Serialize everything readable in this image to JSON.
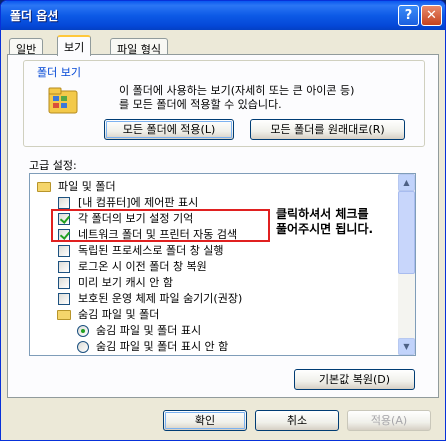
{
  "window": {
    "title": "폴더 옵션",
    "help": "?",
    "close": "✕"
  },
  "tabs": [
    "일반",
    "보기",
    "파일 형식"
  ],
  "folder_views": {
    "group_title": "폴더 보기",
    "description": [
      "이 폴더에 사용하는 보기(자세히 또는 큰 아이콘 등)",
      "를 모든 폴더에 적용할 수 있습니다."
    ],
    "apply_all": "모든 폴더에 적용(L)",
    "reset_all": "모든 폴더를 원래대로(R)"
  },
  "advanced": {
    "label": "고급 설정:",
    "items": [
      {
        "kind": "folder",
        "label": "파일 및 폴더",
        "level": 0
      },
      {
        "kind": "checkbox",
        "label": "[내 컴퓨터]에 제어판 표시",
        "checked": false,
        "level": 1
      },
      {
        "kind": "checkbox",
        "label": "각 폴더의 보기 설정 기억",
        "checked": true,
        "level": 1
      },
      {
        "kind": "checkbox",
        "label": "네트워크 폴더 및 프린터 자동 검색",
        "checked": true,
        "level": 1
      },
      {
        "kind": "checkbox",
        "label": "독립된 프로세스로 폴더 창 실행",
        "checked": false,
        "level": 1
      },
      {
        "kind": "checkbox",
        "label": "로그온 시 이전 폴더 창 복원",
        "checked": false,
        "level": 1
      },
      {
        "kind": "checkbox",
        "label": "미리 보기 캐시 안 함",
        "checked": false,
        "level": 1
      },
      {
        "kind": "checkbox",
        "label": "보호된 운영 체제 파일 숨기기(권장)",
        "checked": false,
        "level": 1
      },
      {
        "kind": "folder",
        "label": "숨김 파일 및 폴더",
        "level": 1
      },
      {
        "kind": "radio",
        "label": "숨김 파일 및 폴더 표시",
        "checked": true,
        "level": 2
      },
      {
        "kind": "radio",
        "label": "숨김 파일 및 폴더 표시 안 함",
        "checked": false,
        "level": 2
      }
    ],
    "restore_defaults": "기본값 복원(D)"
  },
  "annotation": [
    "클릭하셔서 체크를",
    "풀어주시면 됩니다."
  ],
  "footer": {
    "ok": "확인",
    "cancel": "취소",
    "apply": "적용(A)"
  },
  "colors": {
    "highlight": "#e02020",
    "group_title": "#0046d5",
    "title_bar": "#0a58ef"
  }
}
